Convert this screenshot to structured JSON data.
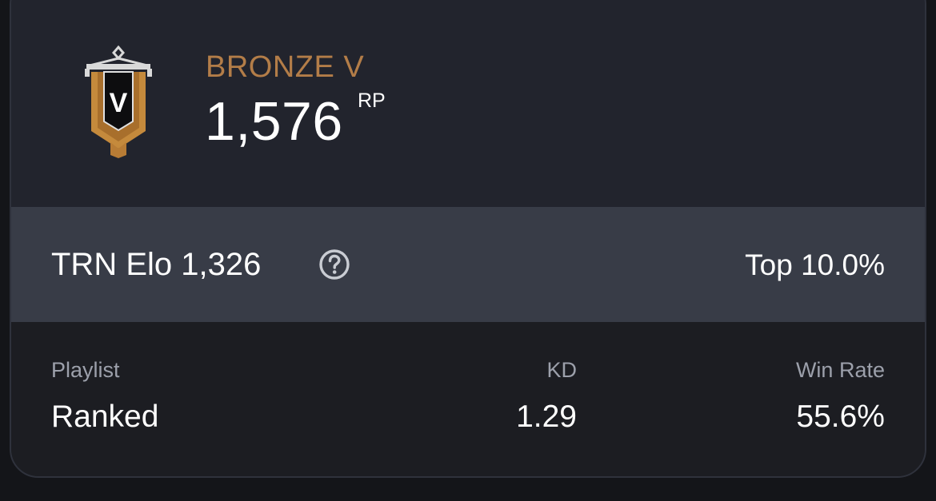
{
  "rank": {
    "name": "BRONZE V",
    "badge_letter": "V",
    "rp_value": "1,576",
    "rp_unit": "RP",
    "colors": {
      "accent": "#b37d48",
      "badge_gold": "#c58a3c"
    }
  },
  "elo": {
    "label": "TRN Elo 1,326",
    "help_icon": "question-circle-icon",
    "top_percent": "Top 10.0%"
  },
  "stats": {
    "columns": [
      {
        "header": "Playlist",
        "value": "Ranked"
      },
      {
        "header": "KD",
        "value": "1.29"
      },
      {
        "header": "Win Rate",
        "value": "55.6%"
      }
    ]
  }
}
